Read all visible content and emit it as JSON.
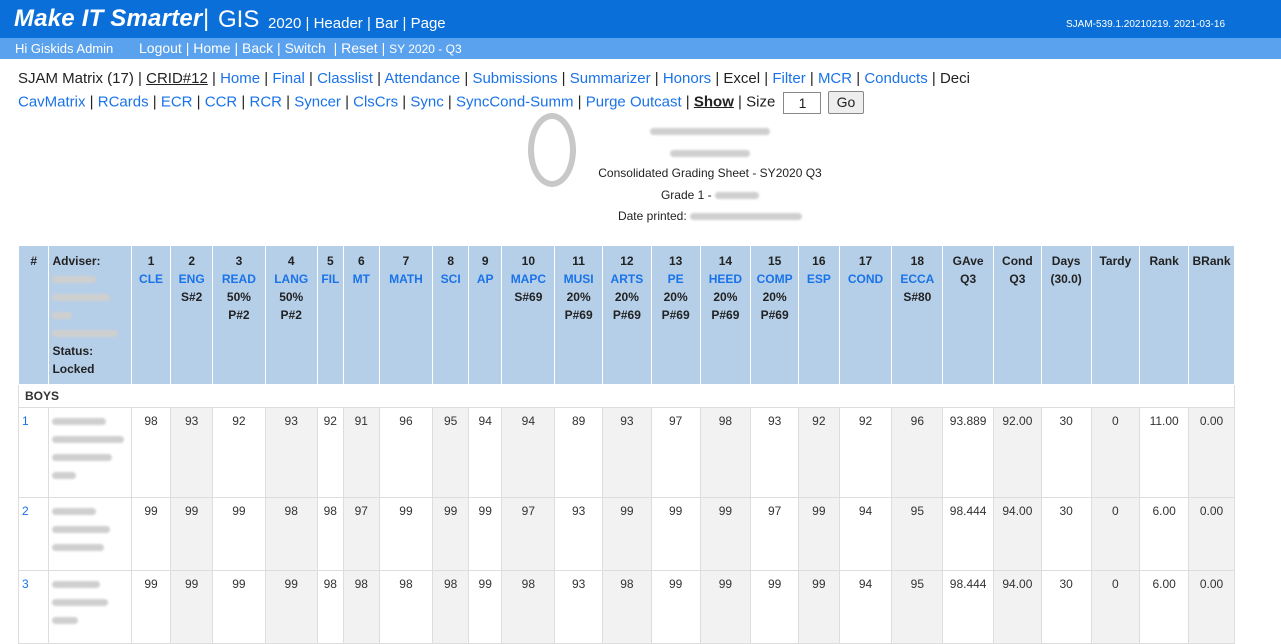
{
  "topbar": {
    "brand": "Make IT Smarter",
    "separator": "|",
    "gis": "GIS",
    "nav": "2020  | Header | Bar | Page",
    "version": "SJAM-539.1.20210219. 2021-03-16"
  },
  "subbar": {
    "greeting": "Hi Giskids Admin",
    "logout": "Logout",
    "home": "Home",
    "back": "Back",
    "switch": "Switch",
    "reset": "Reset",
    "sy": "SY 2020 - Q3"
  },
  "links1": {
    "title": "SJAM Matrix (17)",
    "crid": "CRID#12",
    "items": [
      "Home",
      "Final",
      "Classlist",
      "Attendance",
      "Submissions",
      "Summarizer",
      "Honors"
    ],
    "excel": "Excel",
    "items2": [
      "Filter",
      "MCR",
      "Conducts"
    ],
    "deci": "Deci"
  },
  "links2": {
    "items": [
      "CavMatrix",
      "RCards",
      "ECR",
      "CCR",
      "RCR",
      "Syncer",
      "ClsCrs",
      "Sync",
      "SyncCond-Summ",
      "Purge Outcast"
    ],
    "show": "Show",
    "size_label": "Size",
    "size_value": "1",
    "go": "Go"
  },
  "header": {
    "sheet_title": "Consolidated Grading Sheet - SY2020 Q3",
    "grade_prefix": "Grade 1 -",
    "date_label": "Date printed:"
  },
  "table": {
    "hash": "#",
    "adviser_label": "Adviser:",
    "status_label": "Status:",
    "status_value": "Locked",
    "columns": [
      {
        "num": "1",
        "code": "CLE",
        "extra": []
      },
      {
        "num": "2",
        "code": "ENG",
        "extra": [
          "S#2"
        ]
      },
      {
        "num": "3",
        "code": "READ",
        "extra": [
          "50%",
          "P#2"
        ]
      },
      {
        "num": "4",
        "code": "LANG",
        "extra": [
          "50%",
          "P#2"
        ]
      },
      {
        "num": "5",
        "code": "FIL",
        "extra": []
      },
      {
        "num": "6",
        "code": "MT",
        "extra": []
      },
      {
        "num": "7",
        "code": "MATH",
        "extra": []
      },
      {
        "num": "8",
        "code": "SCI",
        "extra": []
      },
      {
        "num": "9",
        "code": "AP",
        "extra": []
      },
      {
        "num": "10",
        "code": "MAPC",
        "extra": [
          "S#69"
        ]
      },
      {
        "num": "11",
        "code": "MUSI",
        "extra": [
          "20%",
          "P#69"
        ]
      },
      {
        "num": "12",
        "code": "ARTS",
        "extra": [
          "20%",
          "P#69"
        ]
      },
      {
        "num": "13",
        "code": "PE",
        "extra": [
          "20%",
          "P#69"
        ]
      },
      {
        "num": "14",
        "code": "HEED",
        "extra": [
          "20%",
          "P#69"
        ]
      },
      {
        "num": "15",
        "code": "COMP",
        "extra": [
          "20%",
          "P#69"
        ]
      },
      {
        "num": "16",
        "code": "ESP",
        "extra": []
      },
      {
        "num": "17",
        "code": "COND",
        "extra": []
      },
      {
        "num": "18",
        "code": "ECCA",
        "extra": [
          "S#80"
        ]
      }
    ],
    "tail_headers": [
      [
        "GAve",
        "Q3"
      ],
      [
        "Cond",
        "Q3"
      ],
      [
        "Days",
        "(30.0)"
      ],
      [
        "Tardy"
      ],
      [
        "Rank"
      ],
      [
        "BRank"
      ]
    ],
    "section_boys": "BOYS",
    "rows": [
      {
        "idx": "1",
        "scores": [
          "98",
          "93",
          "92",
          "93",
          "92",
          "91",
          "96",
          "95",
          "94",
          "94",
          "89",
          "93",
          "97",
          "98",
          "93",
          "92",
          "92",
          "96"
        ],
        "tail": [
          "93.889",
          "92.00",
          "30",
          "0",
          "11.00",
          "0.00"
        ]
      },
      {
        "idx": "2",
        "scores": [
          "99",
          "99",
          "99",
          "98",
          "98",
          "97",
          "99",
          "99",
          "99",
          "97",
          "93",
          "99",
          "99",
          "99",
          "97",
          "99",
          "94",
          "95"
        ],
        "tail": [
          "98.444",
          "94.00",
          "30",
          "0",
          "6.00",
          "0.00"
        ]
      },
      {
        "idx": "3",
        "scores": [
          "99",
          "99",
          "99",
          "99",
          "98",
          "98",
          "98",
          "98",
          "99",
          "98",
          "93",
          "98",
          "99",
          "99",
          "99",
          "99",
          "94",
          "95"
        ],
        "tail": [
          "98.444",
          "94.00",
          "30",
          "0",
          "6.00",
          "0.00"
        ]
      }
    ]
  }
}
